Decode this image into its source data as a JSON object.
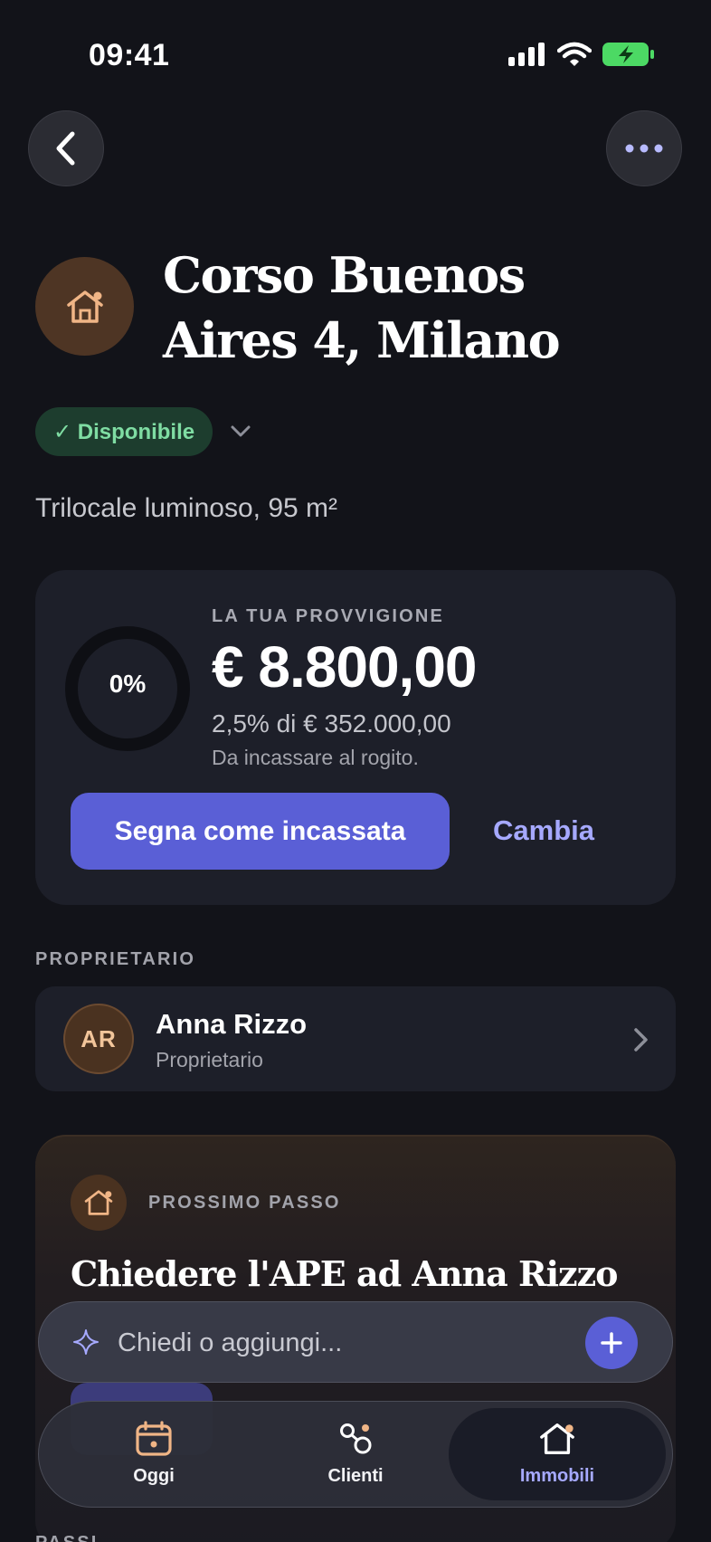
{
  "status_bar": {
    "time": "09:41"
  },
  "header": {
    "title": "Corso Buenos Aires 4, Milano",
    "status": "✓ Disponibile",
    "subtitle": "Trilocale luminoso, 95 m²"
  },
  "commission": {
    "progress_label": "0%",
    "progress_value": 0,
    "label": "LA TUA PROVVIGIONE",
    "amount": "€ 8.800,00",
    "percentage_line": "2,5% di € 352.000,00",
    "due_line": "Da incassare al rogito.",
    "primary_button": "Segna come incassata",
    "secondary_button": "Cambia"
  },
  "owner": {
    "section_label": "PROPRIETARIO",
    "initials": "AR",
    "name": "Anna Rizzo",
    "role": "Proprietario"
  },
  "next_step": {
    "label": "PROSSIMO PASSO",
    "title": "Chiedere l'APE ad Anna Rizzo"
  },
  "ask_bar": {
    "placeholder": "Chiedi o aggiungi..."
  },
  "tabs": [
    {
      "label": "Oggi",
      "icon": "calendar-icon"
    },
    {
      "label": "Clienti",
      "icon": "clients-icon"
    },
    {
      "label": "Immobili",
      "icon": "house-icon",
      "active": true
    }
  ],
  "bottom_section_label": "PASSI",
  "colors": {
    "background": "#121319",
    "card": "#1d1f29",
    "accent": "#5a5fd6",
    "accent_text": "#a6a9ff",
    "available_green": "#7fdda3",
    "house_orange": "#f0b586"
  }
}
